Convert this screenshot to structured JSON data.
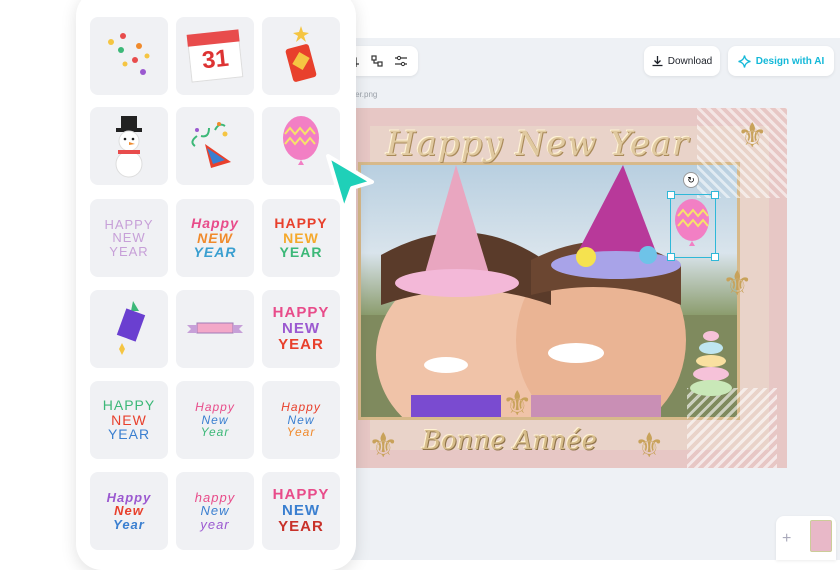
{
  "toolbar": {
    "tools": [
      "crop-icon",
      "layers-icon",
      "adjust-icon"
    ],
    "download_label": "Download",
    "ai_label": "Design with AI",
    "accent_color": "#13b8d8"
  },
  "canvas": {
    "filename": "rder.png",
    "title_top": "Happy New Year",
    "title_bottom": "Bonne Année"
  },
  "stickers": {
    "items": [
      {
        "name": "confetti-dots"
      },
      {
        "name": "calendar-31",
        "text": "31"
      },
      {
        "name": "firecracker"
      },
      {
        "name": "snowman"
      },
      {
        "name": "party-popper"
      },
      {
        "name": "pink-balloon"
      },
      {
        "name": "happy-new-year-1",
        "lines": [
          "HAPPY",
          "NEW",
          "YEAR"
        ]
      },
      {
        "name": "happy-new-year-2",
        "lines": [
          "Happy",
          "NEW",
          "YEAR"
        ]
      },
      {
        "name": "happy-new-year-3",
        "lines": [
          "HAPPY",
          "NEW",
          "YEAR"
        ]
      },
      {
        "name": "rocket-firework"
      },
      {
        "name": "banner-ribbon"
      },
      {
        "name": "happy-new-year-4",
        "lines": [
          "HAPPY",
          "NEW",
          "YEAR"
        ]
      },
      {
        "name": "happy-new-year-5",
        "lines": [
          "HAPPY",
          "NEW",
          "YEAR"
        ]
      },
      {
        "name": "happy-new-year-6",
        "lines": [
          "Happy",
          "New",
          "Year"
        ]
      },
      {
        "name": "happy-new-year-7",
        "lines": [
          "Happy",
          "New",
          "Year"
        ]
      },
      {
        "name": "happy-new-year-8",
        "lines": [
          "Happy",
          "New",
          "Year"
        ]
      },
      {
        "name": "happy-new-year-9",
        "lines": [
          "happy",
          "New",
          "year"
        ]
      },
      {
        "name": "happy-new-year-10",
        "lines": [
          "HAPPY",
          "NEW",
          "YEAR"
        ]
      }
    ]
  }
}
